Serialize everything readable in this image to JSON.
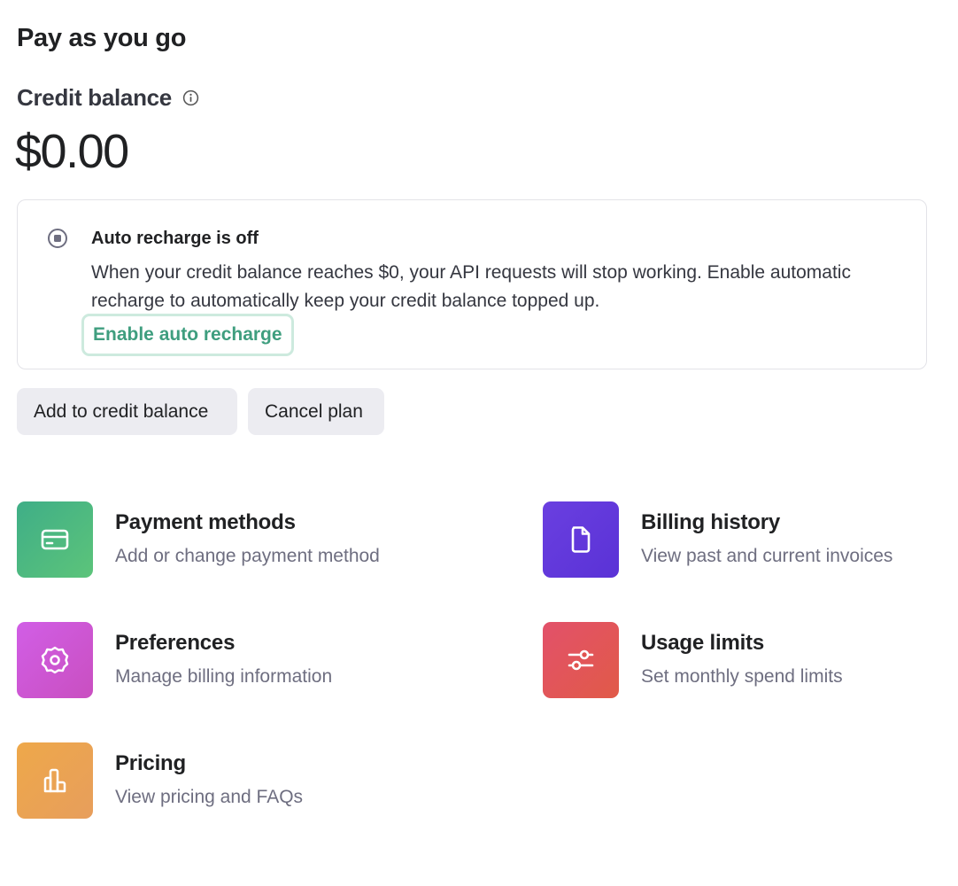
{
  "page": {
    "title": "Pay as you go"
  },
  "credit": {
    "label": "Credit balance",
    "value": "$0.00"
  },
  "auto_recharge": {
    "title": "Auto recharge is off",
    "body": "When your credit balance reaches $0, your API requests will stop working. Enable automatic recharge to automatically keep your credit balance topped up.",
    "link_label": "Enable auto recharge"
  },
  "actions": {
    "add_label": "Add to credit balance",
    "cancel_label": "Cancel plan"
  },
  "tiles": [
    {
      "title": "Payment methods",
      "subtitle": "Add or change payment method",
      "icon": "credit-card-icon",
      "color": "#4ab783"
    },
    {
      "title": "Billing history",
      "subtitle": "View past and current invoices",
      "icon": "document-icon",
      "color": "#5f37dc"
    },
    {
      "title": "Preferences",
      "subtitle": "Manage billing information",
      "icon": "gear-icon",
      "color": "#cd57d8"
    },
    {
      "title": "Usage limits",
      "subtitle": "Set monthly spend limits",
      "icon": "sliders-icon",
      "color": "#e05558"
    },
    {
      "title": "Pricing",
      "subtitle": "View pricing and FAQs",
      "icon": "bar-chart-icon",
      "color": "#eba352"
    }
  ]
}
